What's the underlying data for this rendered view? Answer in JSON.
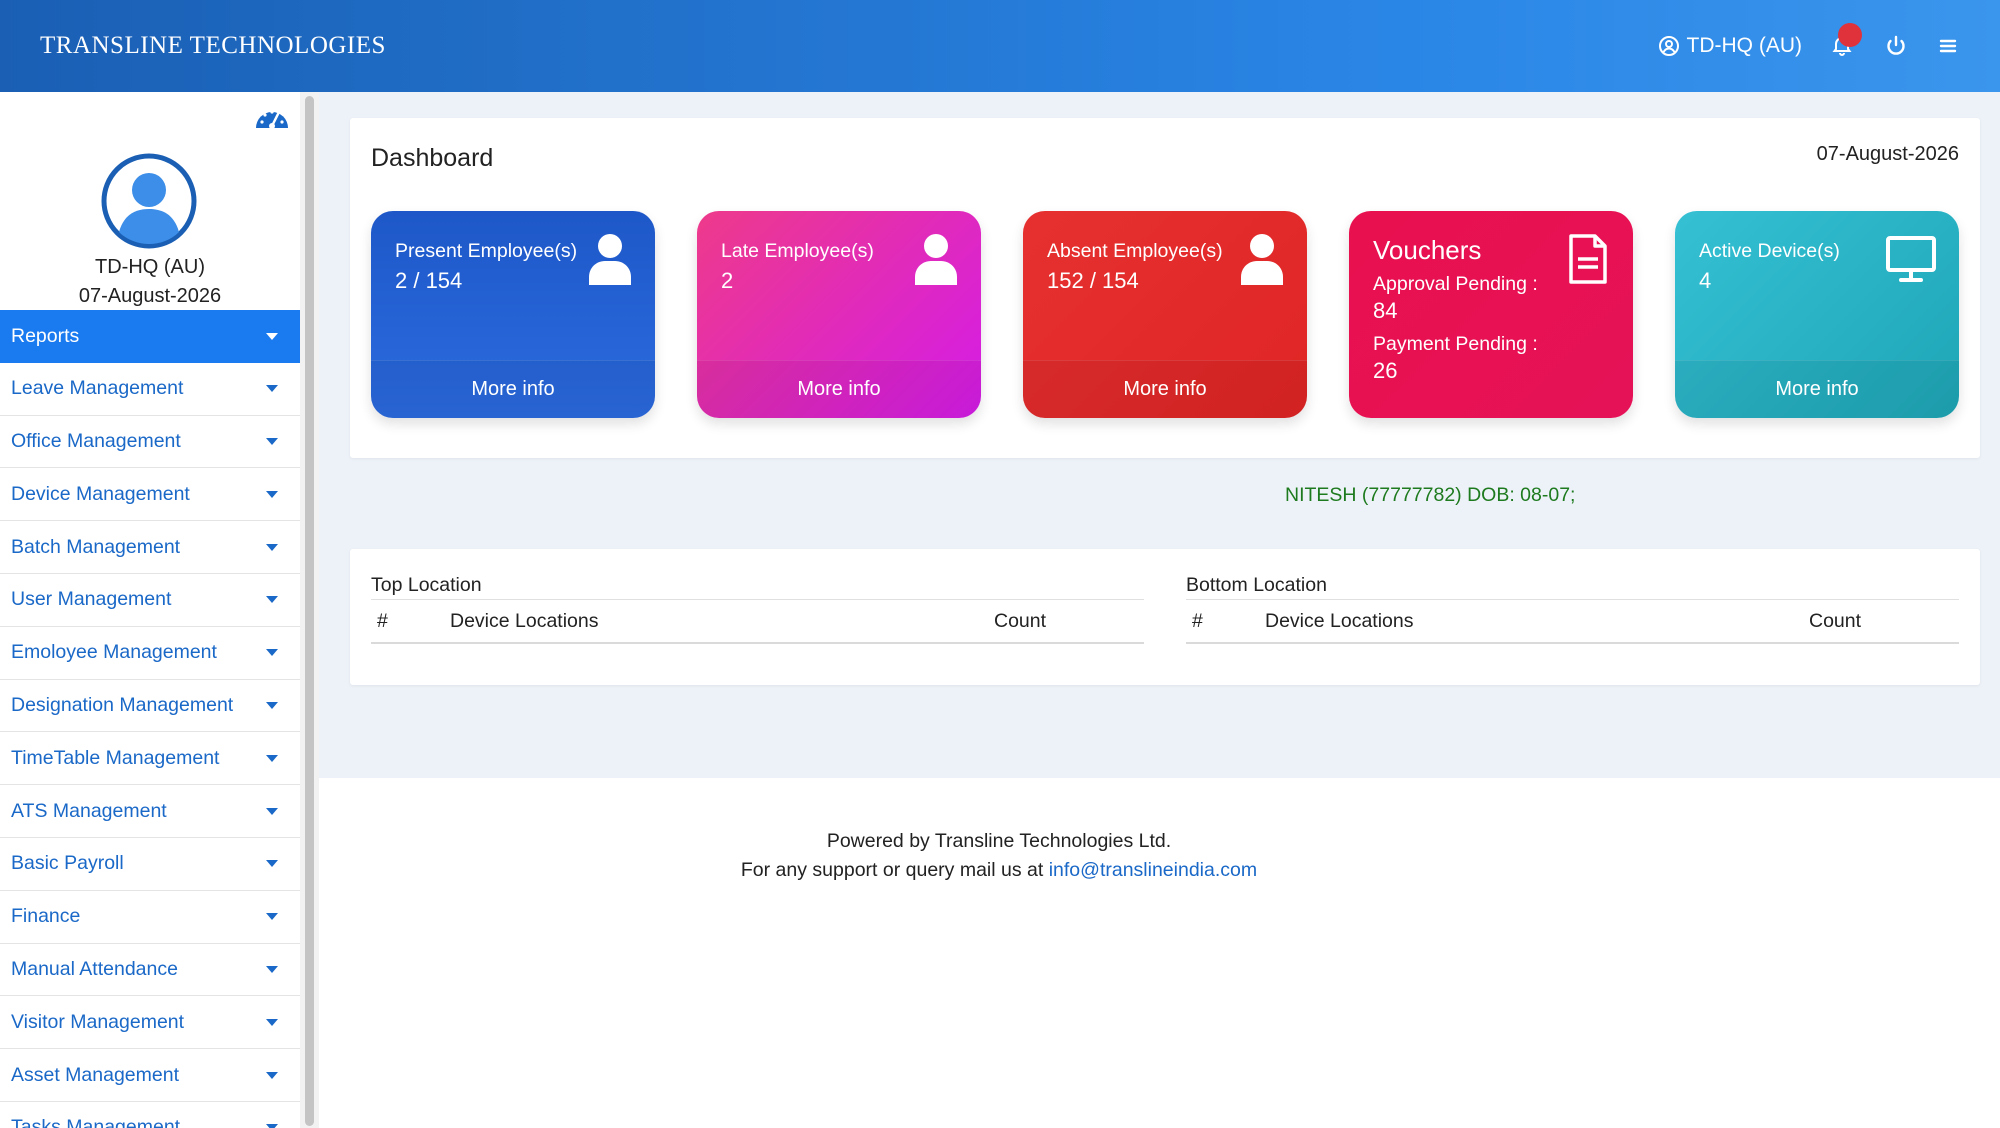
{
  "header": {
    "brand": "TRANSLINE TECHNOLOGIES",
    "user": "TD-HQ (AU)"
  },
  "sidebar": {
    "profile_name": "TD-HQ (AU)",
    "profile_date": "07-August-2026",
    "items": [
      {
        "label": "Reports"
      },
      {
        "label": "Leave Management"
      },
      {
        "label": "Office Management"
      },
      {
        "label": "Device Management"
      },
      {
        "label": "Batch Management"
      },
      {
        "label": "User Management"
      },
      {
        "label": "Emoloyee Management"
      },
      {
        "label": "Designation Management"
      },
      {
        "label": "TimeTable Management"
      },
      {
        "label": "ATS Management"
      },
      {
        "label": "Basic Payroll"
      },
      {
        "label": "Finance"
      },
      {
        "label": "Manual Attendance"
      },
      {
        "label": "Visitor Management"
      },
      {
        "label": "Asset Management"
      },
      {
        "label": "Tasks Management"
      }
    ]
  },
  "dashboard": {
    "title": "Dashboard",
    "date": "07-August-2026",
    "cards": {
      "present": {
        "label": "Present Employee(s)",
        "value": "2 / 154",
        "more": "More info"
      },
      "late": {
        "label": "Late Employee(s)",
        "value": "2",
        "more": "More info"
      },
      "absent": {
        "label": "Absent Employee(s)",
        "value": "152 / 154",
        "more": "More info"
      },
      "vouchers": {
        "label": "Vouchers",
        "approval_label": "Approval Pending :",
        "approval_value": "84",
        "payment_label": "Payment Pending :",
        "payment_value": "26"
      },
      "devices": {
        "label": "Active Device(s)",
        "value": "4",
        "more": "More info"
      }
    },
    "dob_notice": "NITESH (77777782) DOB: 08-07;"
  },
  "locations": {
    "top": {
      "title": "Top Location",
      "col_hash": "#",
      "col_loc": "Device Locations",
      "col_count": "Count"
    },
    "bottom": {
      "title": "Bottom Location",
      "col_hash": "#",
      "col_loc": "Device Locations",
      "col_count": "Count"
    }
  },
  "footer": {
    "line1": "Powered by Transline Technologies Ltd.",
    "line2_prefix": "For any support or query mail us at",
    "email": "info@translineindia.com"
  },
  "colors": {
    "header_start": "#1a5fb4",
    "sidebar_active": "#1a7bf0",
    "menu_text": "#1a68c7",
    "present": "#1e58c8",
    "late": "#d41ce8",
    "absent": "#e02525",
    "vouchers": "#e61258",
    "devices": "#1ea6b6",
    "dob_text": "#1e7a1e"
  }
}
